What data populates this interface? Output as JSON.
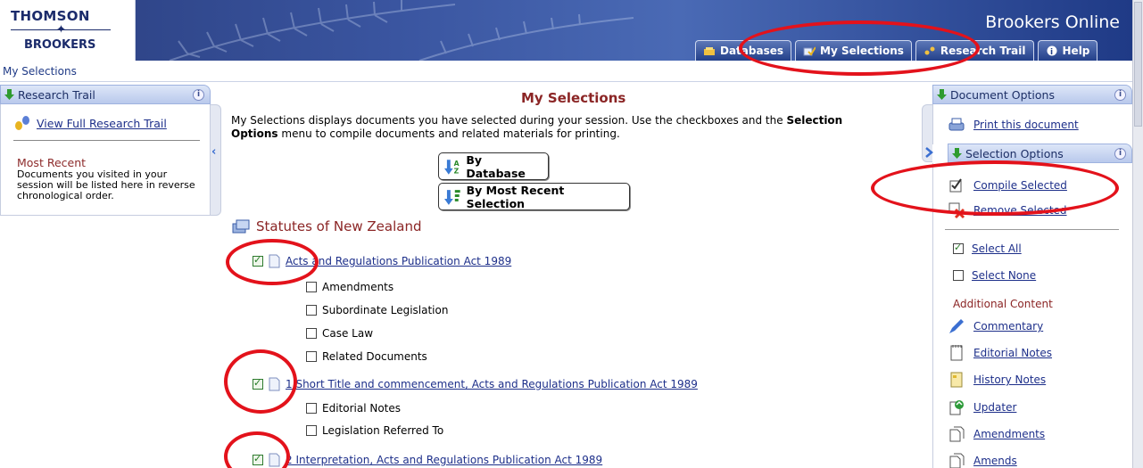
{
  "header": {
    "logo_top": "THOMSON",
    "logo_bottom": "BROOKERS",
    "brand": "Brookers Online",
    "tabs": [
      {
        "label": "Databases",
        "icon": "database-icon"
      },
      {
        "label": "My Selections",
        "icon": "my-selections-icon"
      },
      {
        "label": "Research Trail",
        "icon": "research-trail-icon"
      },
      {
        "label": "Help",
        "icon": "help-icon"
      }
    ]
  },
  "breadcrumb": "My Selections",
  "left_panel": {
    "title": "Research Trail",
    "link": "View Full Research Trail",
    "most_recent_title": "Most Recent",
    "most_recent_text": "Documents you visited in your session will be listed here in reverse chronological order."
  },
  "main": {
    "title": "My Selections",
    "intro_part1": "My Selections displays documents you have selected during your session. Use the checkboxes and the ",
    "intro_bold": "Selection Options",
    "intro_part2": " menu to compile documents and related materials for printing.",
    "sort_by_database": "By Database",
    "sort_by_recent": "By Most Recent Selection",
    "section_title": "Statutes of New Zealand",
    "items": [
      {
        "title": "Acts and Regulations Publication Act 1989",
        "checked": true,
        "sub": [
          "Amendments",
          "Subordinate Legislation",
          "Case Law",
          "Related Documents"
        ]
      },
      {
        "title": "1 Short Title and commencement, Acts and Regulations Publication Act 1989",
        "checked": true,
        "sub": [
          "Editorial Notes",
          "Legislation Referred To"
        ]
      },
      {
        "title": "2 Interpretation, Acts and Regulations Publication Act 1989",
        "checked": true,
        "sub": []
      }
    ]
  },
  "right_panel": {
    "doc_options_title": "Document Options",
    "print": "Print this document",
    "selection_options_title": "Selection Options",
    "compile": "Compile Selected",
    "remove": "Remove Selected",
    "select_all": "Select All",
    "select_none": "Select None",
    "additional_content": "Additional Content",
    "additional": [
      "Commentary",
      "Editorial Notes",
      "History Notes",
      "Updater",
      "Amendments",
      "Amends"
    ]
  },
  "colors": {
    "header_blue": "#2a3e7e",
    "accent_red": "#8b2525",
    "annotation_red": "#e3121b",
    "link_blue": "#1d2f8a"
  }
}
